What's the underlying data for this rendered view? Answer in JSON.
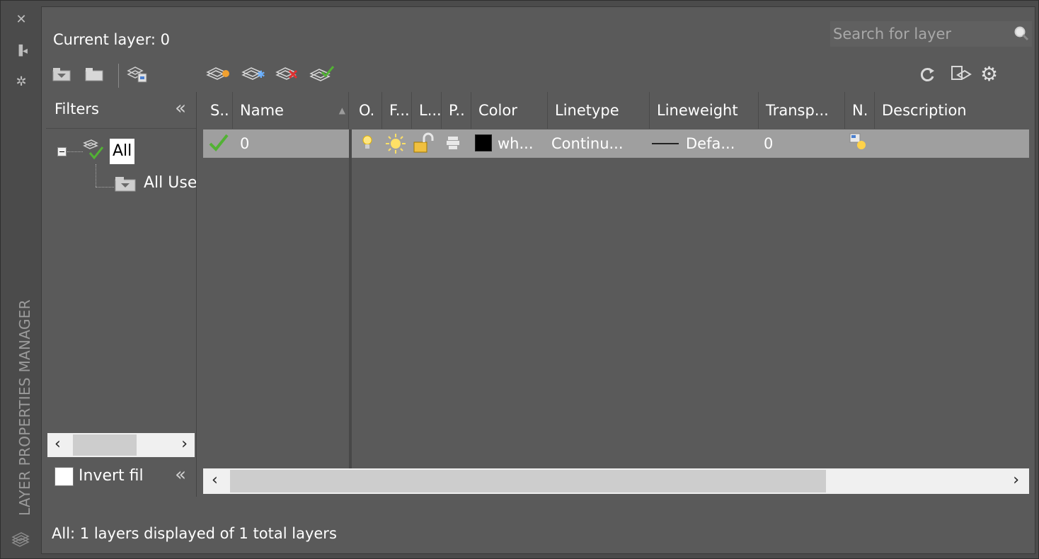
{
  "palette": {
    "vertical_title": "LAYER PROPERTIES MANAGER",
    "strip_icons": [
      "close-icon",
      "autohide-icon",
      "properties-icon",
      "layers-icon"
    ]
  },
  "header": {
    "current_layer": "Current layer: 0",
    "search_placeholder": "Search for layer"
  },
  "toolbar": {
    "left_icons": [
      "new-property-filter-icon",
      "new-group-filter-icon",
      "layer-states-manager-icon"
    ],
    "layer_icons": [
      "new-layer-icon",
      "new-layer-vp-frozen-icon",
      "delete-layer-icon",
      "set-current-icon"
    ],
    "right_icons": [
      "refresh-icon",
      "layer-settings-icon",
      "settings-gear-icon"
    ]
  },
  "filters": {
    "header": "Filters",
    "tree": [
      {
        "label": "All",
        "selected": true
      },
      {
        "label": "All Used Layers",
        "visible_label": "All Use"
      }
    ],
    "invert_label": "Invert filter",
    "invert_visible": "Invert fil",
    "invert_checked": false
  },
  "columns": {
    "status": "S..",
    "name": "Name",
    "on": "O.",
    "freeze": "F...",
    "lock": "L...",
    "plot": "P..",
    "color": "Color",
    "linetype": "Linetype",
    "lineweight": "Lineweight",
    "transparency": "Transp...",
    "new_vp_freeze": "N.",
    "description": "Description"
  },
  "rows": [
    {
      "status": "current",
      "name": "0",
      "on": true,
      "frozen": false,
      "locked": false,
      "plot": true,
      "color_name": "wh...",
      "color_hex": "#000000",
      "linetype": "Continu...",
      "lineweight": "Defa...",
      "transparency": "0",
      "description": ""
    }
  ],
  "status_bar": {
    "text": "All: 1 layers displayed of 1 total layers"
  },
  "colors": {
    "panel_bg": "#5a5a5a",
    "outer_bg": "#4b4b4b",
    "selected_row": "#9f9f9f",
    "current_check": "#52b234"
  }
}
